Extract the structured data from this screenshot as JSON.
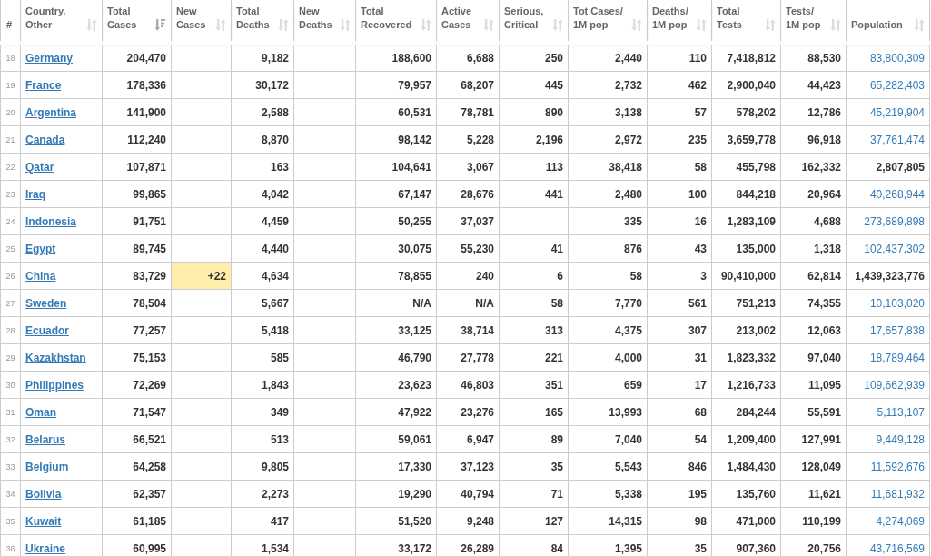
{
  "columns": [
    {
      "label": "#"
    },
    {
      "label": "Country,\nOther",
      "sorted": false
    },
    {
      "label": "Total\nCases",
      "sorted": true
    },
    {
      "label": "New\nCases",
      "sorted": false,
      "kind": "new"
    },
    {
      "label": "Total\nDeaths",
      "sorted": false
    },
    {
      "label": "New\nDeaths",
      "sorted": false
    },
    {
      "label": "Total\nRecovered",
      "sorted": false
    },
    {
      "label": "Active\nCases",
      "sorted": false
    },
    {
      "label": "Serious,\nCritical",
      "sorted": false
    },
    {
      "label": "Tot Cases/\n1M pop",
      "sorted": false
    },
    {
      "label": "Deaths/\n1M pop",
      "sorted": false
    },
    {
      "label": "Total\nTests",
      "sorted": false
    },
    {
      "label": "Tests/\n1M pop",
      "sorted": false
    },
    {
      "label": "Population",
      "sorted": false
    }
  ],
  "rows": [
    {
      "n": "18",
      "country": "Germany",
      "cells": [
        "204,470",
        null,
        "9,182",
        null,
        "188,600",
        "6,688",
        "250",
        "2,440",
        "110",
        "7,418,812",
        "88,530"
      ],
      "population": {
        "text": "83,800,309",
        "link": true
      }
    },
    {
      "n": "19",
      "country": "France",
      "cells": [
        "178,336",
        null,
        "30,172",
        null,
        "79,957",
        "68,207",
        "445",
        "2,732",
        "462",
        "2,900,040",
        "44,423"
      ],
      "population": {
        "text": "65,282,403",
        "link": true
      }
    },
    {
      "n": "20",
      "country": "Argentina",
      "cells": [
        "141,900",
        null,
        "2,588",
        null,
        "60,531",
        "78,781",
        "890",
        "3,138",
        "57",
        "578,202",
        "12,786"
      ],
      "population": {
        "text": "45,219,904",
        "link": true
      }
    },
    {
      "n": "21",
      "country": "Canada",
      "cells": [
        "112,240",
        null,
        "8,870",
        null,
        "98,142",
        "5,228",
        "2,196",
        "2,972",
        "235",
        "3,659,778",
        "96,918"
      ],
      "population": {
        "text": "37,761,474",
        "link": true
      }
    },
    {
      "n": "22",
      "country": "Qatar",
      "cells": [
        "107,871",
        null,
        "163",
        null,
        "104,641",
        "3,067",
        "113",
        "38,418",
        "58",
        "455,798",
        "162,332"
      ],
      "population": {
        "text": "2,807,805",
        "link": false
      }
    },
    {
      "n": "23",
      "country": "Iraq",
      "cells": [
        "99,865",
        null,
        "4,042",
        null,
        "67,147",
        "28,676",
        "441",
        "2,480",
        "100",
        "844,218",
        "20,964"
      ],
      "population": {
        "text": "40,268,944",
        "link": true
      }
    },
    {
      "n": "24",
      "country": "Indonesia",
      "cells": [
        "91,751",
        null,
        "4,459",
        null,
        "50,255",
        "37,037",
        null,
        "335",
        "16",
        "1,283,109",
        "4,688"
      ],
      "population": {
        "text": "273,689,898",
        "link": true
      }
    },
    {
      "n": "25",
      "country": "Egypt",
      "cells": [
        "89,745",
        null,
        "4,440",
        null,
        "30,075",
        "55,230",
        "41",
        "876",
        "43",
        "135,000",
        "1,318"
      ],
      "population": {
        "text": "102,437,302",
        "link": true
      }
    },
    {
      "n": "26",
      "country": "China",
      "cells": [
        "83,729",
        "+22",
        "4,634",
        null,
        "78,855",
        "240",
        "6",
        "58",
        "3",
        "90,410,000",
        "62,814"
      ],
      "population": {
        "text": "1,439,323,776",
        "link": false
      }
    },
    {
      "n": "27",
      "country": "Sweden",
      "cells": [
        "78,504",
        null,
        "5,667",
        null,
        "N/A",
        "N/A",
        "58",
        "7,770",
        "561",
        "751,213",
        "74,355"
      ],
      "population": {
        "text": "10,103,020",
        "link": true
      }
    },
    {
      "n": "28",
      "country": "Ecuador",
      "cells": [
        "77,257",
        null,
        "5,418",
        null,
        "33,125",
        "38,714",
        "313",
        "4,375",
        "307",
        "213,002",
        "12,063"
      ],
      "population": {
        "text": "17,657,838",
        "link": true
      }
    },
    {
      "n": "29",
      "country": "Kazakhstan",
      "cells": [
        "75,153",
        null,
        "585",
        null,
        "46,790",
        "27,778",
        "221",
        "4,000",
        "31",
        "1,823,332",
        "97,040"
      ],
      "population": {
        "text": "18,789,464",
        "link": true
      }
    },
    {
      "n": "30",
      "country": "Philippines",
      "cells": [
        "72,269",
        null,
        "1,843",
        null,
        "23,623",
        "46,803",
        "351",
        "659",
        "17",
        "1,216,733",
        "11,095"
      ],
      "population": {
        "text": "109,662,939",
        "link": true
      }
    },
    {
      "n": "31",
      "country": "Oman",
      "cells": [
        "71,547",
        null,
        "349",
        null,
        "47,922",
        "23,276",
        "165",
        "13,993",
        "68",
        "284,244",
        "55,591"
      ],
      "population": {
        "text": "5,113,107",
        "link": true
      }
    },
    {
      "n": "32",
      "country": "Belarus",
      "cells": [
        "66,521",
        null,
        "513",
        null,
        "59,061",
        "6,947",
        "89",
        "7,040",
        "54",
        "1,209,400",
        "127,991"
      ],
      "population": {
        "text": "9,449,128",
        "link": true
      }
    },
    {
      "n": "33",
      "country": "Belgium",
      "cells": [
        "64,258",
        null,
        "9,805",
        null,
        "17,330",
        "37,123",
        "35",
        "5,543",
        "846",
        "1,484,430",
        "128,049"
      ],
      "population": {
        "text": "11,592,676",
        "link": true
      }
    },
    {
      "n": "34",
      "country": "Bolivia",
      "cells": [
        "62,357",
        null,
        "2,273",
        null,
        "19,290",
        "40,794",
        "71",
        "5,338",
        "195",
        "135,760",
        "11,621"
      ],
      "population": {
        "text": "11,681,932",
        "link": true
      }
    },
    {
      "n": "35",
      "country": "Kuwait",
      "cells": [
        "61,185",
        null,
        "417",
        null,
        "51,520",
        "9,248",
        "127",
        "14,315",
        "98",
        "471,000",
        "110,199"
      ],
      "population": {
        "text": "4,274,069",
        "link": true
      }
    },
    {
      "n": "36",
      "country": "Ukraine",
      "cells": [
        "60,995",
        null,
        "1,534",
        null,
        "33,172",
        "26,289",
        "84",
        "1,395",
        "35",
        "907,360",
        "20,756"
      ],
      "population": {
        "text": "43,716,569",
        "link": true
      }
    }
  ]
}
